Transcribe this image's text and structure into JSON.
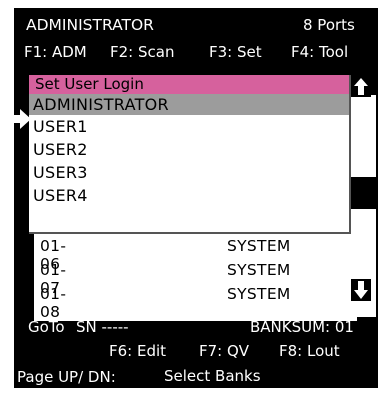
{
  "header": {
    "title": "ADMINISTRATOR",
    "ports": "8 Ports"
  },
  "fkeys_top": [
    {
      "label": "F1: ADM"
    },
    {
      "label": "F2: Scan"
    },
    {
      "label": "F3: Set"
    },
    {
      "label": "F4: Tool"
    }
  ],
  "popup": {
    "title": "Set User Login",
    "items": [
      "ADMINISTRATOR",
      "USER1",
      "USER2",
      "USER3",
      "USER4"
    ],
    "selected": "ADMINISTRATOR"
  },
  "list": {
    "rows": [
      {
        "port": "01-06",
        "name": "SYSTEM"
      },
      {
        "port": "01-07",
        "name": "SYSTEM"
      },
      {
        "port": "01-08",
        "name": "SYSTEM"
      }
    ]
  },
  "footer": {
    "goto": "GoTo",
    "sn": "SN -----",
    "banksum": "BANKSUM: 01",
    "f6": "F6: Edit",
    "f7": "F7: QV",
    "f8": "F8: Lout",
    "pageupdn": "Page UP/ DN:",
    "select_banks": "Select Banks"
  },
  "colors": {
    "popup_title_bg": "#d6619d",
    "selection_bg": "#9c9c9c",
    "panel_bg": "#000000"
  },
  "icons": [
    "pointer-arrow-icon",
    "scroll-up-icon",
    "scroll-down-icon"
  ]
}
